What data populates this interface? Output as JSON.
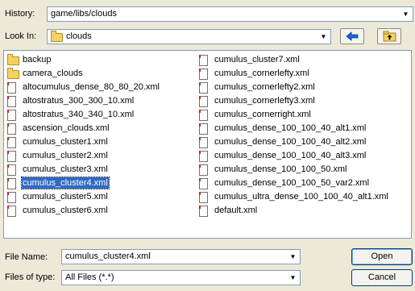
{
  "history": {
    "label": "History:",
    "value": "game/libs/clouds"
  },
  "look_in": {
    "label": "Look In:",
    "value": "clouds"
  },
  "files_left": [
    {
      "name": "backup",
      "type": "folder"
    },
    {
      "name": "camera_clouds",
      "type": "folder"
    },
    {
      "name": "altocumulus_dense_80_80_20.xml",
      "type": "file"
    },
    {
      "name": "altostratus_300_300_10.xml",
      "type": "file"
    },
    {
      "name": "altostratus_340_340_10.xml",
      "type": "file"
    },
    {
      "name": "ascension_clouds.xml",
      "type": "file"
    },
    {
      "name": "cumulus_cluster1.xml",
      "type": "file"
    },
    {
      "name": "cumulus_cluster2.xml",
      "type": "file"
    },
    {
      "name": "cumulus_cluster3.xml",
      "type": "file"
    },
    {
      "name": "cumulus_cluster4.xml",
      "type": "file",
      "selected": true
    },
    {
      "name": "cumulus_cluster5.xml",
      "type": "file"
    },
    {
      "name": "cumulus_cluster6.xml",
      "type": "file"
    }
  ],
  "files_right": [
    {
      "name": "cumulus_cluster7.xml",
      "type": "file"
    },
    {
      "name": "cumulus_cornerlefty.xml",
      "type": "file"
    },
    {
      "name": "cumulus_cornerlefty2.xml",
      "type": "file"
    },
    {
      "name": "cumulus_cornerlefty3.xml",
      "type": "file"
    },
    {
      "name": "cumulus_cornerright.xml",
      "type": "file"
    },
    {
      "name": "cumulus_dense_100_100_40_alt1.xml",
      "type": "file"
    },
    {
      "name": "cumulus_dense_100_100_40_alt2.xml",
      "type": "file"
    },
    {
      "name": "cumulus_dense_100_100_40_alt3.xml",
      "type": "file"
    },
    {
      "name": "cumulus_dense_100_100_50.xml",
      "type": "file"
    },
    {
      "name": "cumulus_dense_100_100_50_var2.xml",
      "type": "file"
    },
    {
      "name": "cumulus_ultra_dense_100_100_40_alt1.xml",
      "type": "file"
    },
    {
      "name": "default.xml",
      "type": "file"
    }
  ],
  "file_name": {
    "label": "File Name:",
    "value": "cumulus_cluster4.xml"
  },
  "file_type": {
    "label": "Files of type:",
    "value": "All Files (*.*)"
  },
  "buttons": {
    "open": "Open",
    "cancel": "Cancel"
  },
  "icons": {
    "up_folder": "up-folder-icon",
    "back": "back-arrow-icon"
  }
}
